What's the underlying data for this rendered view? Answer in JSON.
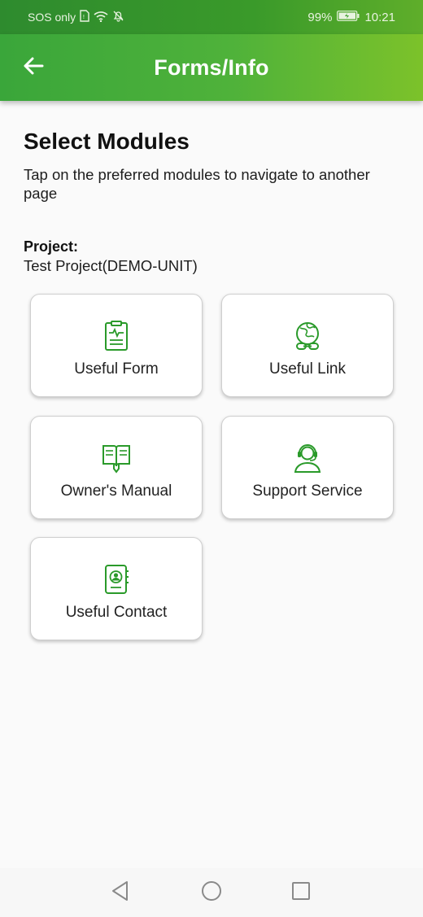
{
  "status": {
    "carrier": "SOS only",
    "battery": "99%",
    "time": "10:21"
  },
  "appbar": {
    "title": "Forms/Info",
    "back_icon": "arrow-left-icon"
  },
  "page": {
    "heading": "Select Modules",
    "subtitle": "Tap on the preferred modules to navigate to another page",
    "project_label": "Project:",
    "project_value": "Test Project(DEMO-UNIT)"
  },
  "modules": [
    {
      "label": "Useful Form",
      "icon": "clipboard-form-icon"
    },
    {
      "label": "Useful Link",
      "icon": "globe-link-icon"
    },
    {
      "label": "Owner's Manual",
      "icon": "manual-book-icon"
    },
    {
      "label": "Support Service",
      "icon": "headset-support-icon"
    },
    {
      "label": "Useful Contact",
      "icon": "contact-book-icon"
    }
  ],
  "colors": {
    "accent": "#2a9a2a",
    "appbar_start": "#3aa63a",
    "appbar_end": "#7cc22a"
  }
}
